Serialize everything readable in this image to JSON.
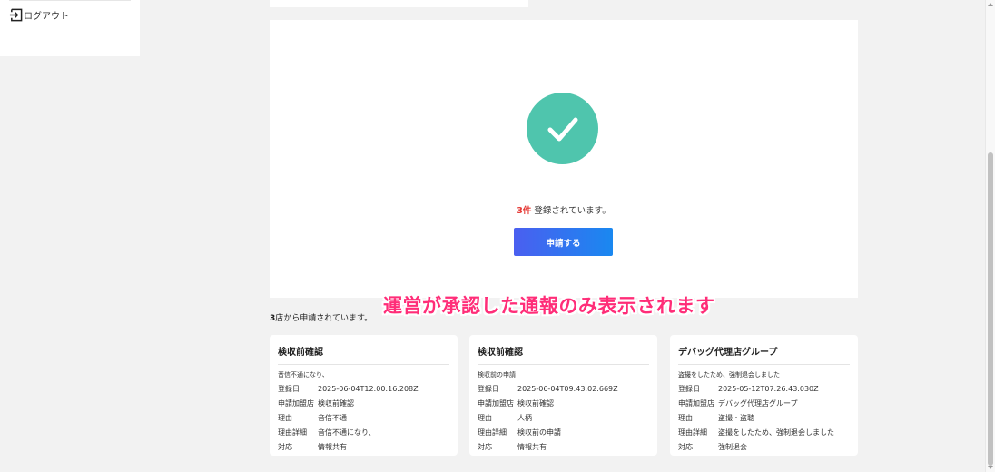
{
  "sidebar": {
    "logout_label": "ログアウト"
  },
  "main": {
    "count": "3件",
    "count_suffix": " 登録されています。",
    "apply_button": "申請する",
    "check_color": "#4fc5ad"
  },
  "annotation": {
    "text": "運営が承認した通報のみ表示されます"
  },
  "summary": {
    "count": "3",
    "text": "店から申請されています。"
  },
  "reports": [
    {
      "title": "検収前確認",
      "description": "音信不通になり、",
      "rows": [
        {
          "label": "登録日",
          "value": "2025-06-04T12:00:16.208Z"
        },
        {
          "label": "申請加盟店",
          "value": "検収前確認"
        },
        {
          "label": "理由",
          "value": "音信不通"
        },
        {
          "label": "理由詳細",
          "value": "音信不通になり、"
        },
        {
          "label": "対応",
          "value": "情報共有"
        }
      ]
    },
    {
      "title": "検収前確認",
      "description": "検収前の申請",
      "rows": [
        {
          "label": "登録日",
          "value": "2025-06-04T09:43:02.669Z"
        },
        {
          "label": "申請加盟店",
          "value": "検収前確認"
        },
        {
          "label": "理由",
          "value": "人柄"
        },
        {
          "label": "理由詳細",
          "value": "検収前の申請"
        },
        {
          "label": "対応",
          "value": "情報共有"
        }
      ]
    },
    {
      "title": "デバッグ代理店グループ",
      "description": "盗撮をしたため、強制退会しました",
      "rows": [
        {
          "label": "登録日",
          "value": "2025-05-12T07:26:43.030Z"
        },
        {
          "label": "申請加盟店",
          "value": "デバッグ代理店グループ"
        },
        {
          "label": "理由",
          "value": "盗撮・盗聴"
        },
        {
          "label": "理由詳細",
          "value": "盗撮をしたため、強制退会しました"
        },
        {
          "label": "対応",
          "value": "強制退会"
        }
      ]
    }
  ],
  "icons": {
    "logout": "logout-icon",
    "check": "check-icon"
  }
}
